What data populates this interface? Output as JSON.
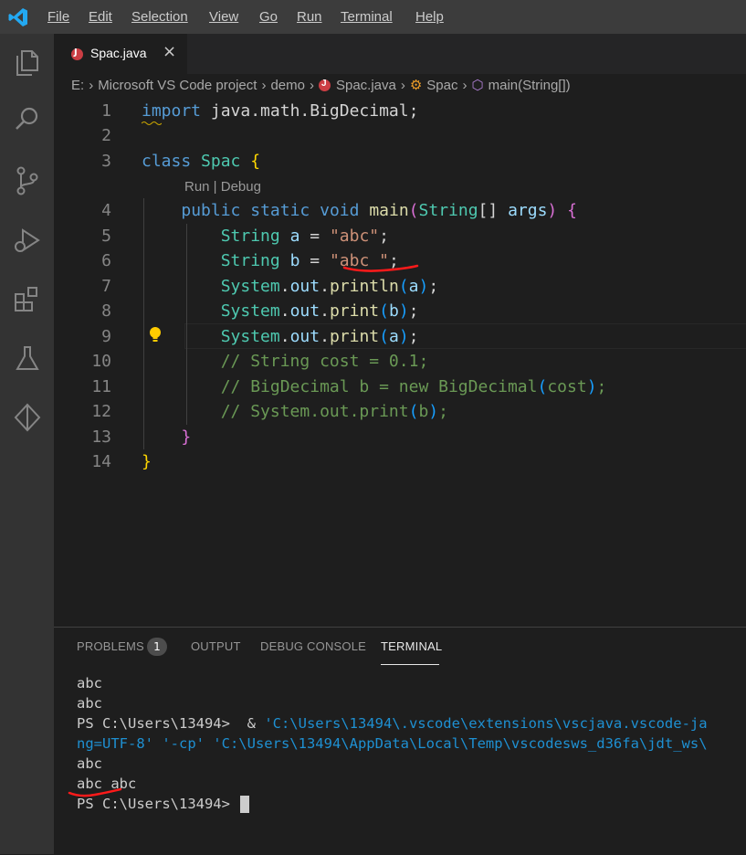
{
  "menu": [
    "File",
    "Edit",
    "Selection",
    "View",
    "Go",
    "Run",
    "Terminal",
    "Help"
  ],
  "tab": {
    "label": "Spac.java",
    "close": "×"
  },
  "breadcrumb": {
    "drive": "E:",
    "folder1": "Microsoft VS Code project",
    "folder2": "demo",
    "file": "Spac.java",
    "cls": "Spac",
    "method": "main(String[])"
  },
  "editor": {
    "line_numbers": [
      "1",
      "2",
      "3",
      "4",
      "5",
      "6",
      "7",
      "8",
      "9",
      "10",
      "11",
      "12",
      "13",
      "14"
    ],
    "codelens": "Run | Debug"
  },
  "panel": {
    "tabs": [
      "PROBLEMS",
      "OUTPUT",
      "DEBUG CONSOLE",
      "TERMINAL"
    ],
    "problems_count": "1",
    "terminal_lines": [
      "abc",
      "abc",
      "PS C:\\Users\\13494>  & ",
      "'C:\\Users\\13494\\.vscode\\extensions\\vscjava.vscode-ja",
      "ng=UTF-8' '-cp' 'C:\\Users\\13494\\AppData\\Local\\Temp\\vscodesws_d36fa\\jdt_ws\\",
      "abc",
      "abc abc",
      "PS C:\\Users\\13494> "
    ]
  },
  "colors": {
    "accent": "#007acc",
    "squiggle": "#ff0000"
  }
}
